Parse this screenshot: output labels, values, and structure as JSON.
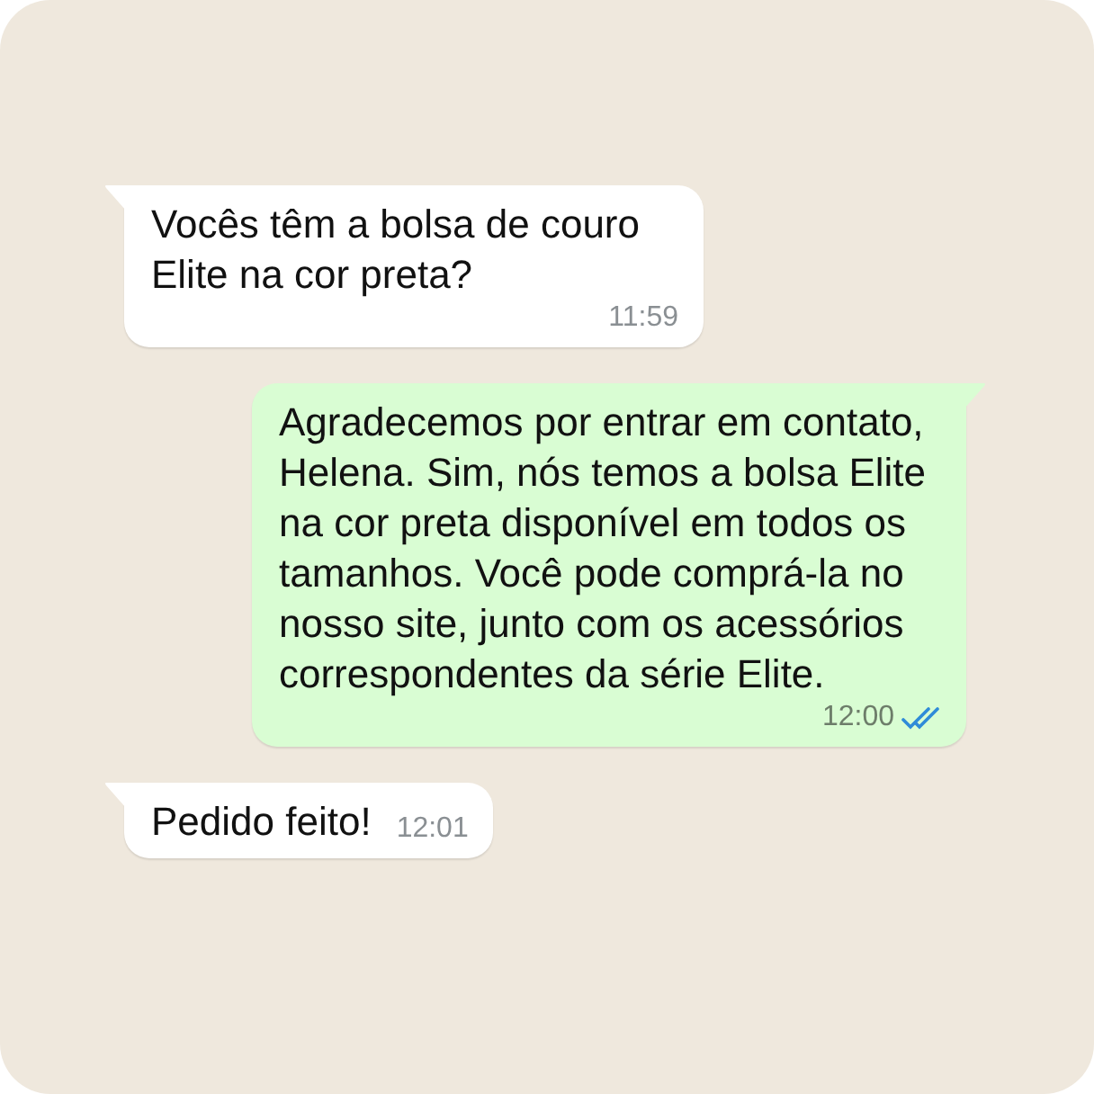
{
  "messages": [
    {
      "kind": "incoming",
      "text": "Vocês têm a bolsa de couro Elite na cor preta?",
      "time": "11:59"
    },
    {
      "kind": "outgoing",
      "text": "Agradecemos por entrar em contato, Helena. Sim, nós temos a bolsa Elite na cor preta disponível em todos os tamanhos. Você pode comprá-la no nosso site, junto com os acessórios correspondentes da série Elite.",
      "time": "12:00",
      "read": true
    },
    {
      "kind": "incoming",
      "text": "Pedido feito!",
      "time": "12:01"
    }
  ]
}
